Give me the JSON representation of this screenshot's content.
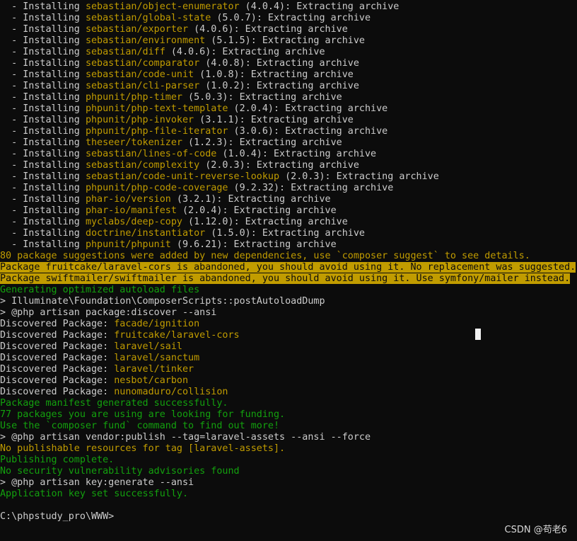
{
  "colors": {
    "background": "#0c0c0c",
    "default_text": "#cccccc",
    "package_name": "#c19c00",
    "success": "#13a10e",
    "warning_bg": "#c19c00",
    "warning_fg": "#0c0c0c"
  },
  "installs": [
    {
      "prefix": "  - Installing ",
      "pkg": "sebastian/object-enumerator",
      "ver": " (4.0.4)",
      "suffix": ": Extracting archive"
    },
    {
      "prefix": "  - Installing ",
      "pkg": "sebastian/global-state",
      "ver": " (5.0.7)",
      "suffix": ": Extracting archive"
    },
    {
      "prefix": "  - Installing ",
      "pkg": "sebastian/exporter",
      "ver": " (4.0.6)",
      "suffix": ": Extracting archive"
    },
    {
      "prefix": "  - Installing ",
      "pkg": "sebastian/environment",
      "ver": " (5.1.5)",
      "suffix": ": Extracting archive"
    },
    {
      "prefix": "  - Installing ",
      "pkg": "sebastian/diff",
      "ver": " (4.0.6)",
      "suffix": ": Extracting archive"
    },
    {
      "prefix": "  - Installing ",
      "pkg": "sebastian/comparator",
      "ver": " (4.0.8)",
      "suffix": ": Extracting archive"
    },
    {
      "prefix": "  - Installing ",
      "pkg": "sebastian/code-unit",
      "ver": " (1.0.8)",
      "suffix": ": Extracting archive"
    },
    {
      "prefix": "  - Installing ",
      "pkg": "sebastian/cli-parser",
      "ver": " (1.0.2)",
      "suffix": ": Extracting archive"
    },
    {
      "prefix": "  - Installing ",
      "pkg": "phpunit/php-timer",
      "ver": " (5.0.3)",
      "suffix": ": Extracting archive"
    },
    {
      "prefix": "  - Installing ",
      "pkg": "phpunit/php-text-template",
      "ver": " (2.0.4)",
      "suffix": ": Extracting archive"
    },
    {
      "prefix": "  - Installing ",
      "pkg": "phpunit/php-invoker",
      "ver": " (3.1.1)",
      "suffix": ": Extracting archive"
    },
    {
      "prefix": "  - Installing ",
      "pkg": "phpunit/php-file-iterator",
      "ver": " (3.0.6)",
      "suffix": ": Extracting archive"
    },
    {
      "prefix": "  - Installing ",
      "pkg": "theseer/tokenizer",
      "ver": " (1.2.3)",
      "suffix": ": Extracting archive"
    },
    {
      "prefix": "  - Installing ",
      "pkg": "sebastian/lines-of-code",
      "ver": " (1.0.4)",
      "suffix": ": Extracting archive"
    },
    {
      "prefix": "  - Installing ",
      "pkg": "sebastian/complexity",
      "ver": " (2.0.3)",
      "suffix": ": Extracting archive"
    },
    {
      "prefix": "  - Installing ",
      "pkg": "sebastian/code-unit-reverse-lookup",
      "ver": " (2.0.3)",
      "suffix": ": Extracting archive"
    },
    {
      "prefix": "  - Installing ",
      "pkg": "phpunit/php-code-coverage",
      "ver": " (9.2.32)",
      "suffix": ": Extracting archive"
    },
    {
      "prefix": "  - Installing ",
      "pkg": "phar-io/version",
      "ver": " (3.2.1)",
      "suffix": ": Extracting archive"
    },
    {
      "prefix": "  - Installing ",
      "pkg": "phar-io/manifest",
      "ver": " (2.0.4)",
      "suffix": ": Extracting archive"
    },
    {
      "prefix": "  - Installing ",
      "pkg": "myclabs/deep-copy",
      "ver": " (1.12.0)",
      "suffix": ": Extracting archive"
    },
    {
      "prefix": "  - Installing ",
      "pkg": "doctrine/instantiator",
      "ver": " (1.5.0)",
      "suffix": ": Extracting archive"
    },
    {
      "prefix": "  - Installing ",
      "pkg": "phpunit/phpunit",
      "ver": " (9.6.21)",
      "suffix": ": Extracting archive"
    }
  ],
  "messages": {
    "suggestions": "80 package suggestions were added by new dependencies, use `composer suggest` to see details.",
    "warning_1": "Package fruitcake/laravel-cors is abandoned, you should avoid using it. No replacement was suggested.",
    "warning_2": "Package swiftmailer/swiftmailer is abandoned, you should avoid using it. Use symfony/mailer instead.",
    "autoload": "Generating optimized autoload files",
    "post_autoload": "> Illuminate\\Foundation\\ComposerScripts::postAutoloadDump",
    "discover_cmd": "> @php artisan package:discover --ansi",
    "manifest_ok": "Package manifest generated successfully.",
    "funding_1": "77 packages you are using are looking for funding.",
    "funding_2": "Use the `composer fund` command to find out more!",
    "vendor_publish_cmd": "> @php artisan vendor:publish --tag=laravel-assets --ansi --force",
    "no_publishable": "No publishable resources for tag [laravel-assets].",
    "publish_complete": "Publishing complete.",
    "no_vuln": "No security vulnerability advisories found",
    "key_generate_cmd": "> @php artisan key:generate --ansi",
    "key_set": "Application key set successfully.",
    "prompt": "C:\\phpstudy_pro\\WWW>"
  },
  "discovered": {
    "label": "Discovered Package: ",
    "packages": [
      "facade/ignition",
      "fruitcake/laravel-cors",
      "laravel/sail",
      "laravel/sanctum",
      "laravel/tinker",
      "nesbot/carbon",
      "nunomaduro/collision"
    ]
  },
  "watermark": "CSDN @苟老6"
}
